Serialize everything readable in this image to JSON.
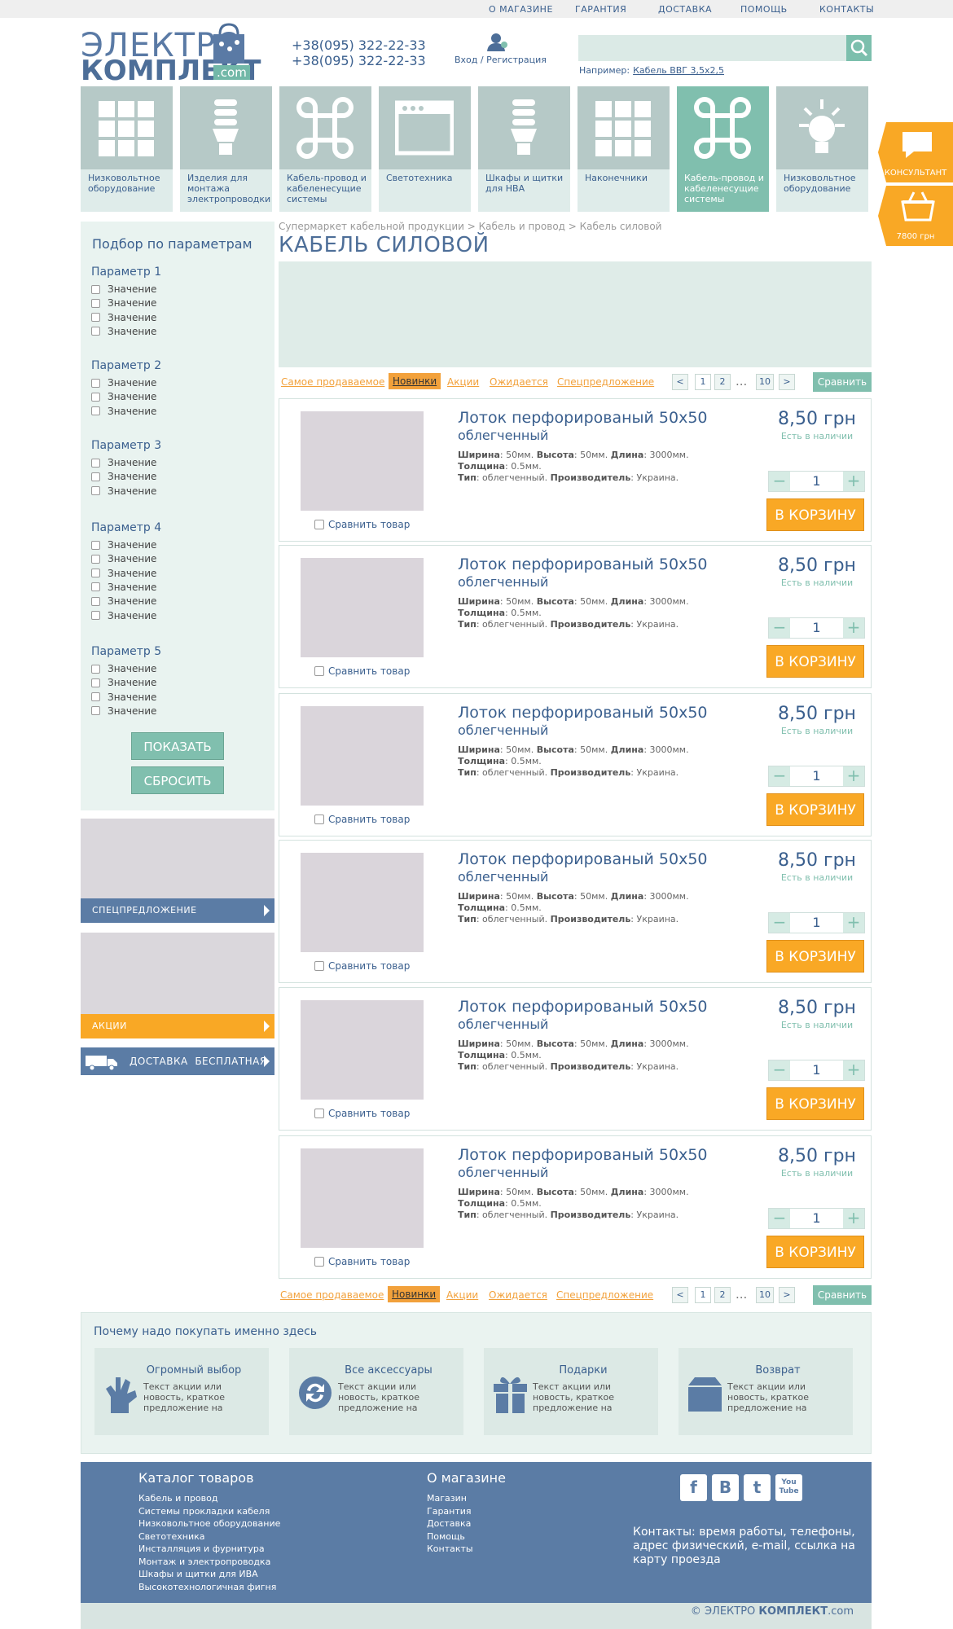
{
  "topnav": [
    "О МАГАЗИНЕ",
    "ГАРАНТИЯ",
    "ДОСТАВКА",
    "ПОМОЩЬ",
    "КОНТАКТЫ"
  ],
  "logo": {
    "top": "ЭЛЕКТРО",
    "bottom": "КОМПЛЕКТ",
    "com": ".com"
  },
  "phones": [
    "+38(095) 322-22-33",
    "+38(095) 322-22-33"
  ],
  "login": "Вход / Регистрация",
  "search": {
    "placeholder": "",
    "example_label": "Например:",
    "example_link": "Кабель ВВГ 3,5х2,5"
  },
  "categories": [
    {
      "label": "Низковольтное оборудование",
      "icon": "grid-icon"
    },
    {
      "label": "Изделия для монтажа электропроводки",
      "icon": "bulb-icon"
    },
    {
      "label": "Кабель-провод и кабеленесущие системы",
      "icon": "command-icon"
    },
    {
      "label": "Светотехника",
      "icon": "window-icon"
    },
    {
      "label": "Шкафы и щитки для НВА",
      "icon": "bulb-icon"
    },
    {
      "label": "Наконечники",
      "icon": "grid-icon"
    },
    {
      "label": "Кабель-провод и кабеленесущие системы",
      "icon": "command-icon",
      "active": true
    },
    {
      "label": "Низковольтное оборудование",
      "icon": "sun-plug-icon"
    }
  ],
  "side_widgets": {
    "consultant": "КОНСУЛЬТАНТ",
    "cart_total": "7800 грн"
  },
  "filter": {
    "title": "Подбор по параметрам",
    "groups": [
      {
        "title": "Параметр 1",
        "values": [
          "Значение",
          "Значение",
          "Значение",
          "Значение"
        ]
      },
      {
        "title": "Параметр 2",
        "values": [
          "Значение",
          "Значение",
          "Значение"
        ]
      },
      {
        "title": "Параметр 3",
        "values": [
          "Значение",
          "Значение",
          "Значение"
        ]
      },
      {
        "title": "Параметр 4",
        "values": [
          "Значение",
          "Значение",
          "Значение",
          "Значение",
          "Значение",
          "Значение"
        ]
      },
      {
        "title": "Параметр 5",
        "values": [
          "Значение",
          "Значение",
          "Значение",
          "Значение"
        ]
      }
    ],
    "show": "ПОКАЗАТЬ",
    "reset": "СБРОСИТЬ"
  },
  "promos": {
    "special": "СПЕЦПРЕДЛОЖЕНИЕ",
    "actions": "АКЦИИ",
    "delivery": "ДОСТАВКА  БЕСПЛАТНАЯ"
  },
  "breadcrumb": "Супермаркет кабельной продукции > Кабель и провод > Кабель силовой",
  "page_title": "КАБЕЛЬ СИЛОВОЙ",
  "sort": {
    "items": [
      "Самое продаваемое",
      "Новинки",
      "Акции",
      "Ожидается",
      "Спецпредложение"
    ],
    "active": 1
  },
  "pagination": {
    "prev": "<",
    "pages": [
      "1",
      "2"
    ],
    "dots": "...",
    "last": "10",
    "next": ">"
  },
  "compare_button": "Сравнить",
  "products": [
    {
      "name": "Лоток перфорированый 50х50",
      "sub": "облегченный",
      "w_label": "Ширина",
      "w": "50мм.",
      "h_label": "Высота",
      "h": "50мм.",
      "l_label": "Длина",
      "l": "3000мм.",
      "t_label": "Толщина",
      "t": "0.5мм.",
      "type_label": "Тип",
      "type": "облегченный.",
      "m_label": "Производитель",
      "m": "Украина.",
      "price": "8,50 грн",
      "stock": "Есть в наличии",
      "qty": "1",
      "cart": "В КОРЗИНУ",
      "compare": "Сравнить товар"
    },
    {
      "name": "Лоток перфорированый 50х50",
      "sub": "облегченный",
      "w_label": "Ширина",
      "w": "50мм.",
      "h_label": "Высота",
      "h": "50мм.",
      "l_label": "Длина",
      "l": "3000мм.",
      "t_label": "Толщина",
      "t": "0.5мм.",
      "type_label": "Тип",
      "type": "облегченный.",
      "m_label": "Производитель",
      "m": "Украина.",
      "price": "8,50 грн",
      "stock": "Есть в наличии",
      "qty": "1",
      "cart": "В КОРЗИНУ",
      "compare": "Сравнить товар"
    },
    {
      "name": "Лоток перфорированый 50х50",
      "sub": "облегченный",
      "w_label": "Ширина",
      "w": "50мм.",
      "h_label": "Высота",
      "h": "50мм.",
      "l_label": "Длина",
      "l": "3000мм.",
      "t_label": "Толщина",
      "t": "0.5мм.",
      "type_label": "Тип",
      "type": "облегченный.",
      "m_label": "Производитель",
      "m": "Украина.",
      "price": "8,50 грн",
      "stock": "Есть в наличии",
      "qty": "1",
      "cart": "В КОРЗИНУ",
      "compare": "Сравнить товар"
    },
    {
      "name": "Лоток перфорированый 50х50",
      "sub": "облегченный",
      "w_label": "Ширина",
      "w": "50мм.",
      "h_label": "Высота",
      "h": "50мм.",
      "l_label": "Длина",
      "l": "3000мм.",
      "t_label": "Толщина",
      "t": "0.5мм.",
      "type_label": "Тип",
      "type": "облегченный.",
      "m_label": "Производитель",
      "m": "Украина.",
      "price": "8,50 грн",
      "stock": "Есть в наличии",
      "qty": "1",
      "cart": "В КОРЗИНУ",
      "compare": "Сравнить товар"
    },
    {
      "name": "Лоток перфорированый 50х50",
      "sub": "облегченный",
      "w_label": "Ширина",
      "w": "50мм.",
      "h_label": "Высота",
      "h": "50мм.",
      "l_label": "Длина",
      "l": "3000мм.",
      "t_label": "Толщина",
      "t": "0.5мм.",
      "type_label": "Тип",
      "type": "облегченный.",
      "m_label": "Производитель",
      "m": "Украина.",
      "price": "8,50 грн",
      "stock": "Есть в наличии",
      "qty": "1",
      "cart": "В КОРЗИНУ",
      "compare": "Сравнить товар"
    },
    {
      "name": "Лоток перфорированый 50х50",
      "sub": "облегченный",
      "w_label": "Ширина",
      "w": "50мм.",
      "h_label": "Высота",
      "h": "50мм.",
      "l_label": "Длина",
      "l": "3000мм.",
      "t_label": "Толщина",
      "t": "0.5мм.",
      "type_label": "Тип",
      "type": "облегченный.",
      "m_label": "Производитель",
      "m": "Украина.",
      "price": "8,50 грн",
      "stock": "Есть в наличии",
      "qty": "1",
      "cart": "В КОРЗИНУ",
      "compare": "Сравнить товар"
    }
  ],
  "why": {
    "title": "Почему надо покупать именно здесь",
    "cards": [
      {
        "title": "Огромный выбор",
        "text": "Текст акции или новость, краткое предложение на",
        "icon": "hand-ok-icon"
      },
      {
        "title": "Все аксессуары",
        "text": "Текст акции или новость, краткое предложение на",
        "icon": "refresh-icon"
      },
      {
        "title": "Подарки",
        "text": "Текст акции или новость, краткое предложение на",
        "icon": "gift-icon"
      },
      {
        "title": "Возврат",
        "text": "Текст акции или новость, краткое предложение на",
        "icon": "box-icon"
      }
    ]
  },
  "footer": {
    "catalog_title": "Каталог товаров",
    "catalog": [
      "Кабель и провод",
      "Системы прокладки кабеля",
      "Низковольтное оборудование",
      "Светотехника",
      "Инсталляция и фурнитура",
      "Монтаж и электропроводка",
      "Шкафы и щитки для ИВА",
      "Высокотехнологичная фигня"
    ],
    "about_title": "О магазине",
    "about": [
      "Магазин",
      "Гарантия",
      "Доставка",
      "Помощь",
      "Контакты"
    ],
    "social": [
      "f",
      "B",
      "t",
      "You Tube"
    ],
    "contacts": "Контакты: время работы, телефоны, адрес физический, e-mail, ссылка на карту проезда",
    "copyright": "©"
  },
  "colors": {
    "accent": "#80bfae",
    "brand": "#4d6e98",
    "orange": "#f9a825"
  }
}
